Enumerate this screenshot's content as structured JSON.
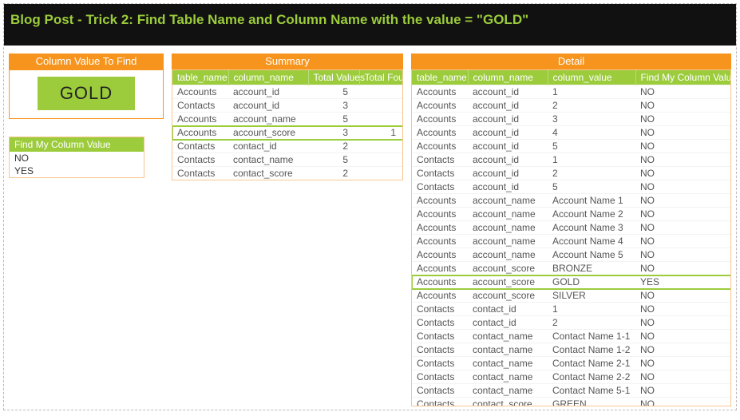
{
  "title": "Blog Post - Trick 2:  Find Table Name and Column Name with the value = \"GOLD\"",
  "find_panel": {
    "title": "Column Value To Find",
    "value": "GOLD"
  },
  "value_list": {
    "header": "Find My Column Value",
    "items": [
      "NO",
      "YES"
    ]
  },
  "summary": {
    "title": "Summary",
    "headers": [
      "table_name",
      "column_name",
      "Total Values",
      "Total Found"
    ],
    "rows": [
      {
        "cells": [
          "Accounts",
          "account_id",
          "5",
          ""
        ],
        "highlight": false
      },
      {
        "cells": [
          "Contacts",
          "account_id",
          "3",
          ""
        ],
        "highlight": false
      },
      {
        "cells": [
          "Accounts",
          "account_name",
          "5",
          ""
        ],
        "highlight": false
      },
      {
        "cells": [
          "Accounts",
          "account_score",
          "3",
          "1"
        ],
        "highlight": true
      },
      {
        "cells": [
          "Contacts",
          "contact_id",
          "2",
          ""
        ],
        "highlight": false
      },
      {
        "cells": [
          "Contacts",
          "contact_name",
          "5",
          ""
        ],
        "highlight": false
      },
      {
        "cells": [
          "Contacts",
          "contact_score",
          "2",
          ""
        ],
        "highlight": false
      }
    ]
  },
  "detail": {
    "title": "Detail",
    "headers": [
      "table_name",
      "column_name",
      "column_value",
      "Find My Column Value"
    ],
    "rows": [
      {
        "cells": [
          "Accounts",
          "account_id",
          "1",
          "NO"
        ],
        "highlight": false
      },
      {
        "cells": [
          "Accounts",
          "account_id",
          "2",
          "NO"
        ],
        "highlight": false
      },
      {
        "cells": [
          "Accounts",
          "account_id",
          "3",
          "NO"
        ],
        "highlight": false
      },
      {
        "cells": [
          "Accounts",
          "account_id",
          "4",
          "NO"
        ],
        "highlight": false
      },
      {
        "cells": [
          "Accounts",
          "account_id",
          "5",
          "NO"
        ],
        "highlight": false
      },
      {
        "cells": [
          "Contacts",
          "account_id",
          "1",
          "NO"
        ],
        "highlight": false
      },
      {
        "cells": [
          "Contacts",
          "account_id",
          "2",
          "NO"
        ],
        "highlight": false
      },
      {
        "cells": [
          "Contacts",
          "account_id",
          "5",
          "NO"
        ],
        "highlight": false
      },
      {
        "cells": [
          "Accounts",
          "account_name",
          "Account Name 1",
          "NO"
        ],
        "highlight": false
      },
      {
        "cells": [
          "Accounts",
          "account_name",
          "Account Name 2",
          "NO"
        ],
        "highlight": false
      },
      {
        "cells": [
          "Accounts",
          "account_name",
          "Account Name 3",
          "NO"
        ],
        "highlight": false
      },
      {
        "cells": [
          "Accounts",
          "account_name",
          "Account Name 4",
          "NO"
        ],
        "highlight": false
      },
      {
        "cells": [
          "Accounts",
          "account_name",
          "Account Name 5",
          "NO"
        ],
        "highlight": false
      },
      {
        "cells": [
          "Accounts",
          "account_score",
          "BRONZE",
          "NO"
        ],
        "highlight": false
      },
      {
        "cells": [
          "Accounts",
          "account_score",
          "GOLD",
          "YES"
        ],
        "highlight": true
      },
      {
        "cells": [
          "Accounts",
          "account_score",
          "SILVER",
          "NO"
        ],
        "highlight": false
      },
      {
        "cells": [
          "Contacts",
          "contact_id",
          "1",
          "NO"
        ],
        "highlight": false
      },
      {
        "cells": [
          "Contacts",
          "contact_id",
          "2",
          "NO"
        ],
        "highlight": false
      },
      {
        "cells": [
          "Contacts",
          "contact_name",
          "Contact Name 1-1",
          "NO"
        ],
        "highlight": false
      },
      {
        "cells": [
          "Contacts",
          "contact_name",
          "Contact Name 1-2",
          "NO"
        ],
        "highlight": false
      },
      {
        "cells": [
          "Contacts",
          "contact_name",
          "Contact Name 2-1",
          "NO"
        ],
        "highlight": false
      },
      {
        "cells": [
          "Contacts",
          "contact_name",
          "Contact Name 2-2",
          "NO"
        ],
        "highlight": false
      },
      {
        "cells": [
          "Contacts",
          "contact_name",
          "Contact Name 5-1",
          "NO"
        ],
        "highlight": false
      },
      {
        "cells": [
          "Contacts",
          "contact_score",
          "GREEN",
          "NO"
        ],
        "highlight": false
      }
    ]
  }
}
